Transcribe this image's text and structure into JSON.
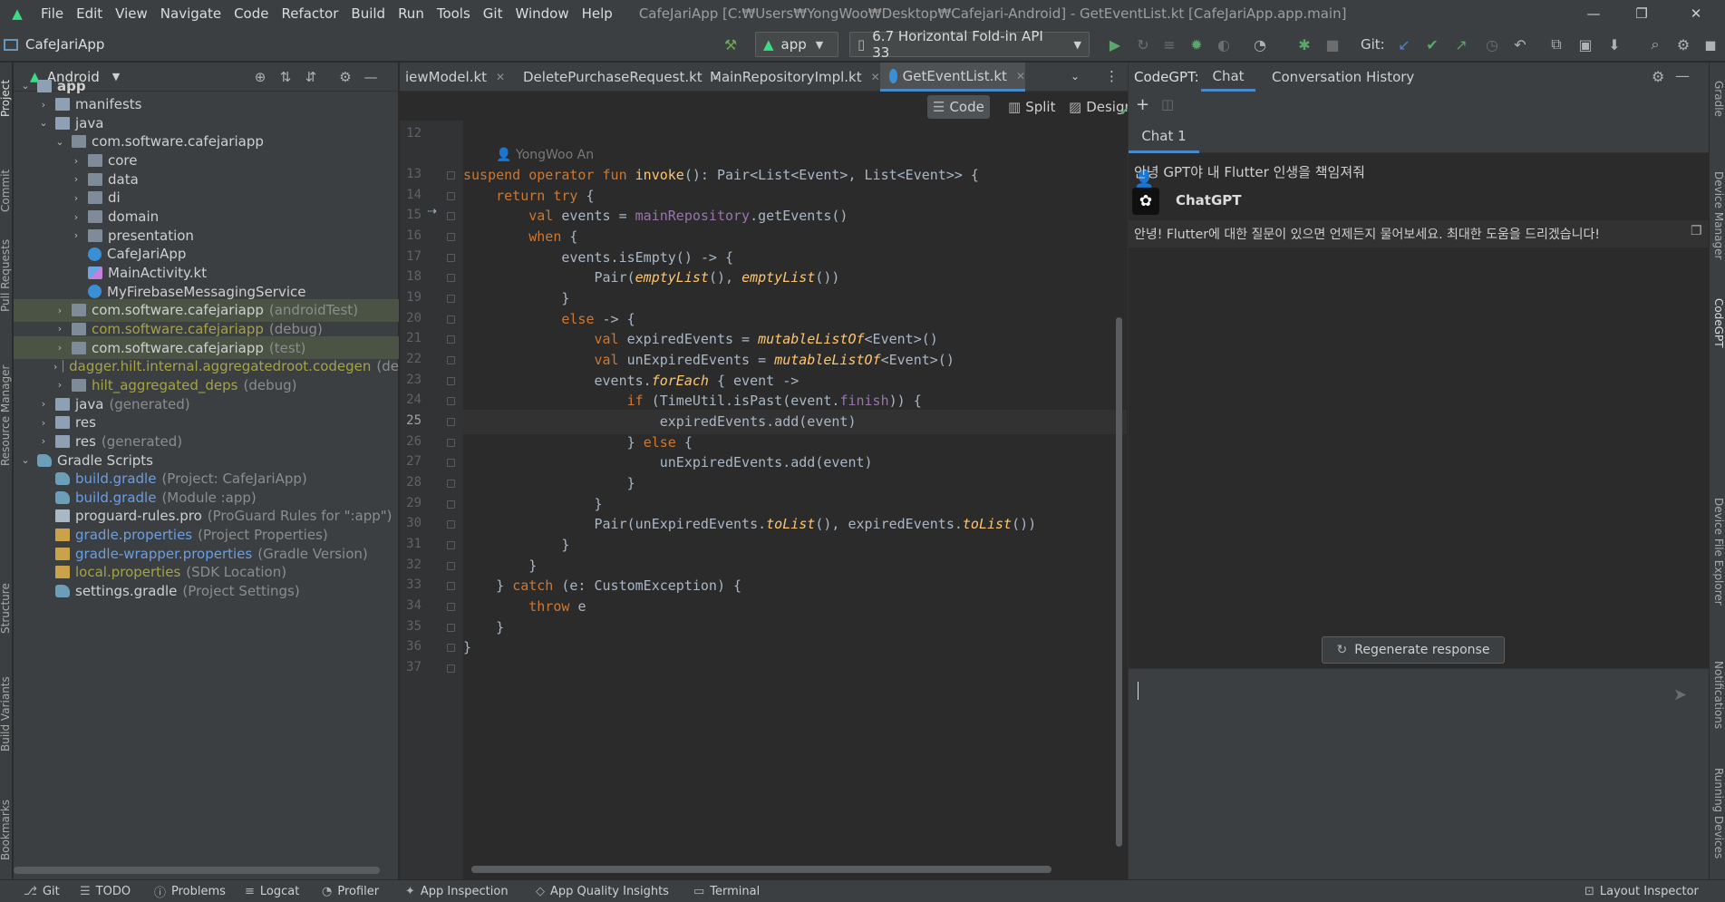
{
  "menubar": {
    "items": [
      "File",
      "Edit",
      "View",
      "Navigate",
      "Code",
      "Refactor",
      "Build",
      "Run",
      "Tools",
      "Git",
      "Window",
      "Help"
    ],
    "window_title": "CafeJariApp [C:₩Users₩YongWoo₩Desktop₩Cafejari-Android] - GetEventList.kt [CafeJariApp.app.main]",
    "minimize": "—",
    "maximize": "❐",
    "close": "✕"
  },
  "toolbar": {
    "project_name": "CafeJariApp",
    "run_config": "app",
    "device": "6.7  Horizontal Fold-in API 33",
    "git_label": "Git:"
  },
  "left_strip": [
    "Project",
    "Commit",
    "Pull Requests",
    "Resource Manager",
    "Structure",
    "Build Variants",
    "Bookmarks"
  ],
  "right_strip": [
    "Gradle",
    "Device Manager",
    "CodeGPT",
    "Device File Explorer",
    "Notifications",
    "Running Devices"
  ],
  "project_panel": {
    "view_mode": "Android",
    "tree": [
      {
        "label": "app",
        "note": "",
        "style": "bold"
      },
      {
        "label": "manifests",
        "note": "",
        "style": "normal"
      },
      {
        "label": "java",
        "note": "",
        "style": "normal"
      },
      {
        "label": "com.software.cafejariapp",
        "note": "",
        "style": "normal"
      },
      {
        "label": "core",
        "note": "",
        "style": "normal"
      },
      {
        "label": "data",
        "note": "",
        "style": "normal"
      },
      {
        "label": "di",
        "note": "",
        "style": "normal"
      },
      {
        "label": "domain",
        "note": "",
        "style": "normal"
      },
      {
        "label": "presentation",
        "note": "",
        "style": "normal"
      },
      {
        "label": "CafeJariApp",
        "note": "",
        "style": "normal"
      },
      {
        "label": "MainActivity.kt",
        "note": "",
        "style": "normal"
      },
      {
        "label": "MyFirebaseMessagingService",
        "note": "",
        "style": "normal"
      },
      {
        "label": "com.software.cafejariapp",
        "note": "(androidTest)",
        "style": "normal"
      },
      {
        "label": "com.software.cafejariapp",
        "note": "(debug)",
        "style": "olive"
      },
      {
        "label": "com.software.cafejariapp",
        "note": "(test)",
        "style": "normal"
      },
      {
        "label": "dagger.hilt.internal.aggregatedroot.codegen",
        "note": "(de",
        "style": "olive"
      },
      {
        "label": "hilt_aggregated_deps",
        "note": "(debug)",
        "style": "olive"
      },
      {
        "label": "java",
        "note": "(generated)",
        "style": "normal"
      },
      {
        "label": "res",
        "note": "",
        "style": "normal"
      },
      {
        "label": "res",
        "note": "(generated)",
        "style": "normal"
      },
      {
        "label": "Gradle Scripts",
        "note": "",
        "style": "normal"
      },
      {
        "label": "build.gradle",
        "note": "(Project: CafeJariApp)",
        "style": "blue"
      },
      {
        "label": "build.gradle",
        "note": "(Module :app)",
        "style": "blue"
      },
      {
        "label": "proguard-rules.pro",
        "note": "(ProGuard Rules for \":app\")",
        "style": "normal"
      },
      {
        "label": "gradle.properties",
        "note": "(Project Properties)",
        "style": "blue"
      },
      {
        "label": "gradle-wrapper.properties",
        "note": "(Gradle Version)",
        "style": "blue"
      },
      {
        "label": "local.properties",
        "note": "(SDK Location)",
        "style": "olive"
      },
      {
        "label": "settings.gradle",
        "note": "(Project Settings)",
        "style": "normal"
      }
    ]
  },
  "editor": {
    "tabs": [
      "iewModel.kt",
      "DeletePurchaseRequest.kt",
      "MainRepositoryImpl.kt",
      "GetEventList.kt"
    ],
    "active_tab": "GetEventList.kt",
    "modes": [
      "Code",
      "Split",
      "Design"
    ],
    "current_line": 25,
    "blame_author": "YongWoo An",
    "line_numbers": [
      "12",
      "13",
      "14",
      "15",
      "16",
      "17",
      "18",
      "19",
      "20",
      "21",
      "22",
      "23",
      "24",
      "25",
      "26",
      "27",
      "28",
      "29",
      "30",
      "31",
      "32",
      "33",
      "34",
      "35",
      "36",
      "37"
    ]
  },
  "codegpt": {
    "title": "CodeGPT:",
    "tabs": [
      "Chat",
      "Conversation History"
    ],
    "chat_tab": "Chat 1",
    "user_message": "안녕 GPT야 내 Flutter 인생을 책임져줘",
    "assistant_name": "ChatGPT",
    "assistant_message": "안녕! Flutter에 대한 질문이 있으면 언제든지 물어보세요. 최대한 도움을 드리겠습니다!",
    "regenerate_label": "Regenerate response",
    "input_value": ""
  },
  "statusbar": {
    "items": [
      "Git",
      "TODO",
      "Problems",
      "Logcat",
      "Profiler",
      "App Inspection",
      "App Quality Insights",
      "Terminal"
    ],
    "right_item": "Layout Inspector"
  },
  "colors": {
    "background": "#2b2b2b",
    "panel": "#3c3f41",
    "keyword": "#cc7832",
    "function": "#ffc66d",
    "property": "#9876aa",
    "text": "#a9b7c6",
    "accent": "#4a88c7",
    "android_green": "#3ddc84"
  }
}
